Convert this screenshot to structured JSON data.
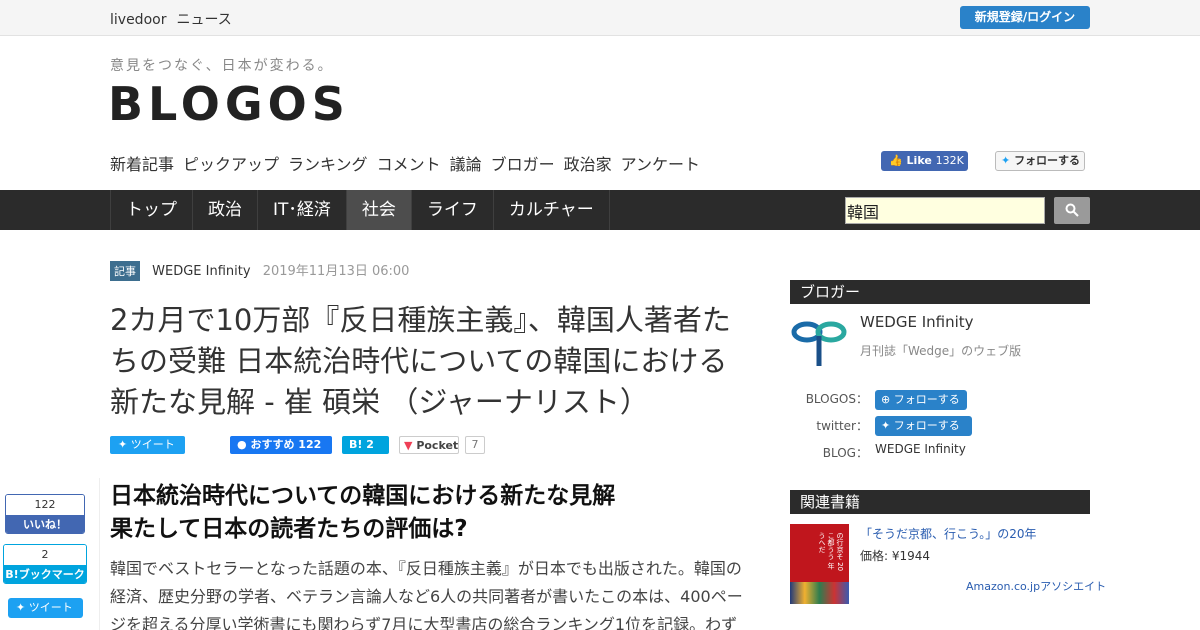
{
  "topbar": {
    "brand": "livedoor",
    "news": "ニュース",
    "login": "新規登録/ログイン"
  },
  "header": {
    "tagline": "意見をつなぐ、日本が変わる。",
    "logo": "BLOGOS"
  },
  "subnav": [
    "新着記事",
    "ピックアップ",
    "ランキング",
    "コメント",
    "議論",
    "ブロガー",
    "政治家",
    "アンケート"
  ],
  "social": {
    "fb_like_label": "Like",
    "fb_like_count": "132K",
    "twitter_follow": "フォローする"
  },
  "mainnav": [
    "トップ",
    "政治",
    "IT･経済",
    "社会",
    "ライフ",
    "カルチャー"
  ],
  "mainnav_active": "社会",
  "search": {
    "value": "韓国"
  },
  "article": {
    "tag": "記事",
    "source": "WEDGE Infinity",
    "date": "2019年11月13日 06:00",
    "title": "2カ月で10万部『反日種族主義』、韓国人著者たちの受難 日本統治時代についての韓国における新たな見解 - 崔 碩栄 （ジャーナリスト）",
    "share": {
      "tweet": "ツイート",
      "fb_label": "おすすめ",
      "fb_count": "122",
      "hb_label": "B!",
      "hb_count": "2",
      "pocket": "Pocket",
      "pocket_count": "7"
    },
    "subhead_1": "日本統治時代についての韓国における新たな見解",
    "subhead_2": "果たして日本の読者たちの評価は?",
    "body": "韓国でベストセラーとなった話題の本、『反日種族主義』が日本でも出版された。韓国の経済、歴史分野の学者、ベテラン言論人など6人の共同著者が書いたこの本は、400ページを超える分厚い学術書にも関わらず7月に大型書店の総合ランキング1位を記録。わず"
  },
  "floating": {
    "like_count": "122",
    "like_label": "いいね！",
    "hb_count": "2",
    "hb_label": "B!ブックマーク",
    "tweet": "ツイート"
  },
  "sidebar": {
    "blogger_heading": "ブロガー",
    "blogger_name": "WEDGE Infinity",
    "blogger_desc": "月刊誌「Wedge」のウェブ版",
    "blogos_label": "BLOGOS：",
    "blogos_follow": "フォローする",
    "twitter_label": "twitter：",
    "twitter_follow": "フォローする",
    "blog_label": "BLOG：",
    "blog_value": "WEDGE Infinity",
    "books_heading": "関連書籍",
    "book_title": "「そうだ京都、行こう。」の20年",
    "book_price": "価格: ¥1944",
    "book_assoc": "Amazon.co.jpアソシエイト",
    "book_cover_text": "の行京そ 20こ都うう 年うへだ"
  },
  "colors": {
    "nav_bg": "#2b2b2b",
    "login_blue": "#2a82c9",
    "facebook": "#4267b2",
    "twitter": "#1da1f2",
    "hatena": "#00a4de"
  }
}
